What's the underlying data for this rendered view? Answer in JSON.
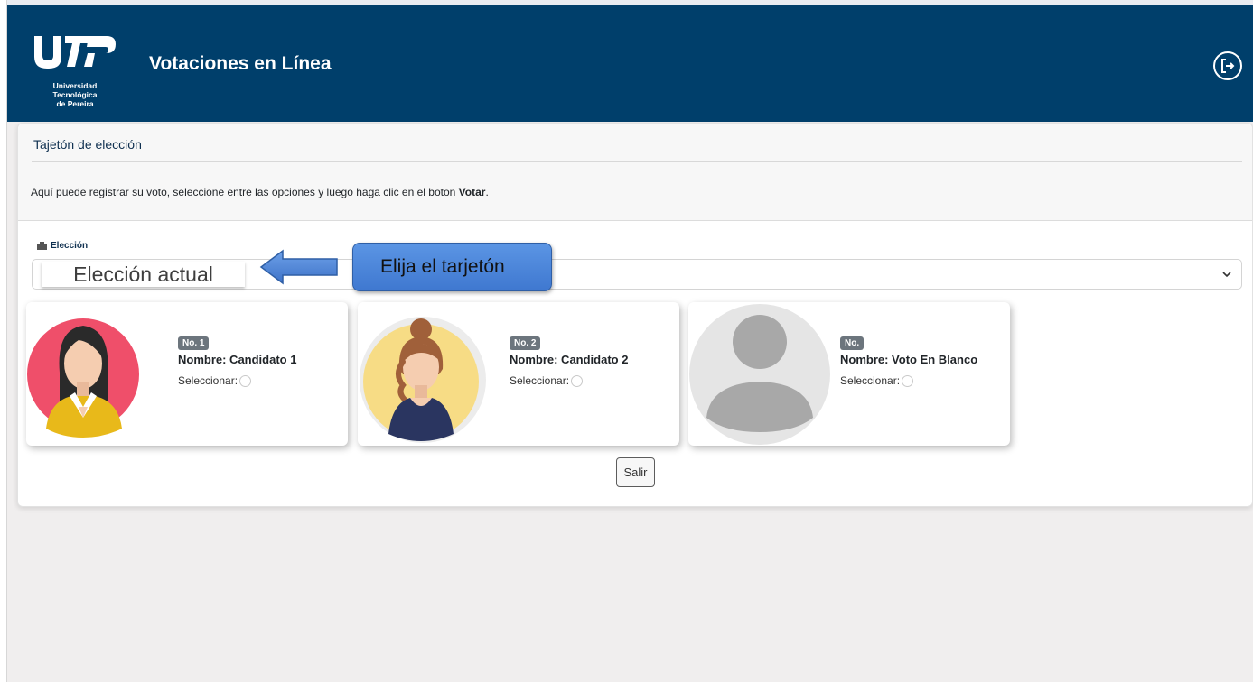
{
  "header": {
    "logo_text": "UTP",
    "logo_subtitle_line1": "Universidad Tecnológica",
    "logo_subtitle_line2": "de Pereira",
    "app_title": "Votaciones en Línea",
    "logout_icon": "logout-icon"
  },
  "card": {
    "title": "Tajetón de elección",
    "instruction_prefix": "Aquí puede registrar su voto, seleccione entre las opciones y luego haga clic en el boton ",
    "instruction_bold": "Votar",
    "instruction_suffix": "."
  },
  "election_field": {
    "label": "Elección",
    "selected_value": "Elección actual"
  },
  "callout": {
    "text": "Elija el tarjetón",
    "color": "#4a86dc"
  },
  "candidates": [
    {
      "number": "No. 1",
      "name": "Nombre: Candidato 1",
      "select_label": "Seleccionar:",
      "avatar": "woman-dark-hair-avatar",
      "avatar_bg": "#ef4f6a"
    },
    {
      "number": "No. 2",
      "name": "Nombre: Candidato 2",
      "select_label": "Seleccionar:",
      "avatar": "woman-bun-hair-avatar",
      "avatar_bg": "#f7dc85"
    },
    {
      "number": "No.",
      "name": "Nombre: Voto En Blanco",
      "select_label": "Seleccionar:",
      "avatar": "blank-user-avatar",
      "avatar_bg": "#e5e5e5"
    }
  ],
  "actions": {
    "exit_label": "Salir"
  },
  "colors": {
    "header_bg": "#003f6b",
    "page_bg": "#f0eeee",
    "badge_bg": "#6c757d"
  }
}
